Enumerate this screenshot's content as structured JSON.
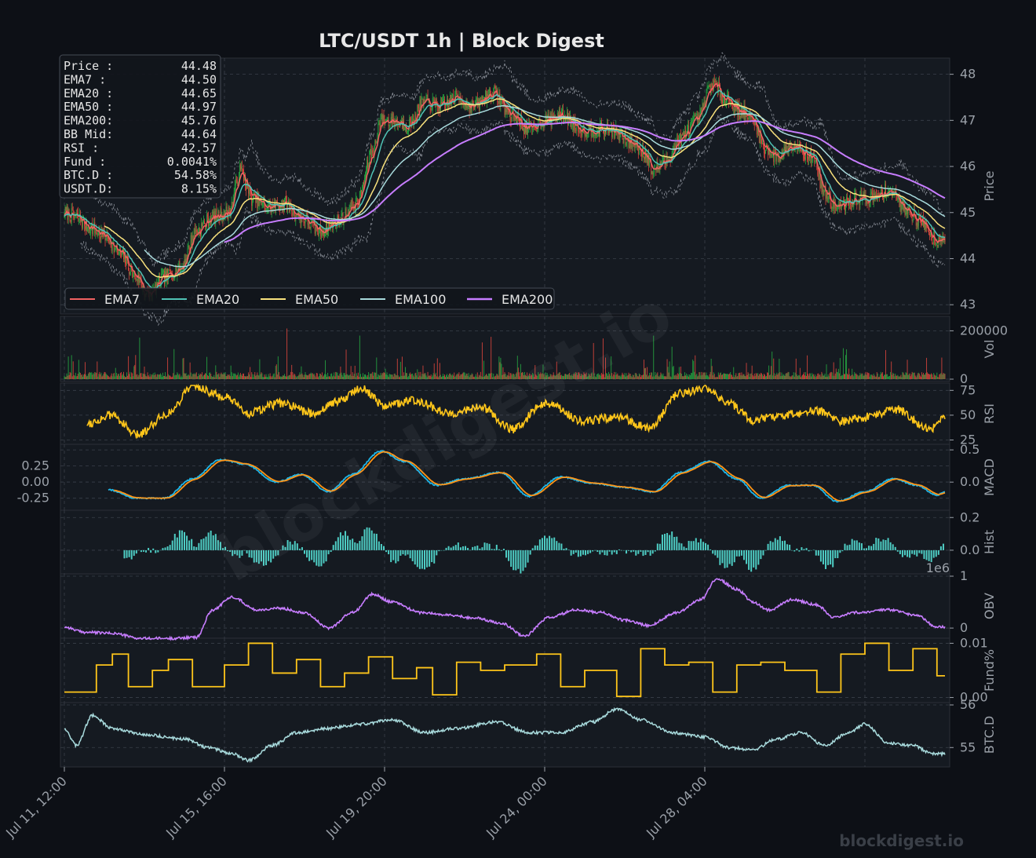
{
  "title": "LTC/USDT  1h  |  Block Digest",
  "watermark": "blockdigest.io",
  "footer_brand": "blockdigest.io",
  "colors": {
    "bg": "#0d1016",
    "panel": "#151a21",
    "grid": "#3a404a",
    "tick": "#9aa0a8",
    "up": "#26a641",
    "down": "#d9453c",
    "ema7": "#f26262",
    "ema20": "#4fc3b5",
    "ema50": "#f9e27d",
    "ema100": "#a8dadc",
    "ema200": "#c77dff",
    "rsi": "#ffc61a",
    "macd": "#1fb6e8",
    "signal": "#ff9416",
    "hist": "#4ecdc4",
    "obv": "#c77dff",
    "fund": "#ffc61a",
    "btcd": "#a8dadc"
  },
  "info_box": [
    {
      "label": "Price :",
      "value": "44.48"
    },
    {
      "label": "EMA7  :",
      "value": "44.50"
    },
    {
      "label": "EMA20 :",
      "value": "44.65"
    },
    {
      "label": "EMA50 :",
      "value": "44.97"
    },
    {
      "label": "EMA200:",
      "value": "45.76"
    },
    {
      "label": "BB Mid:",
      "value": "44.64"
    },
    {
      "label": "RSI   :",
      "value": "42.57"
    },
    {
      "label": "Fund  :",
      "value": "0.0041%"
    },
    {
      "label": "BTC.D :",
      "value": "54.58%"
    },
    {
      "label": "USDT.D:",
      "value": "8.15%"
    }
  ],
  "legend": [
    "EMA7",
    "EMA20",
    "EMA50",
    "EMA100",
    "EMA200"
  ],
  "x_ticks": [
    "Jul 11, 12:00",
    "Jul 15, 16:00",
    "Jul 19, 20:00",
    "Jul 24, 00:00",
    "Jul 28, 04:00"
  ],
  "chart_data": [
    {
      "type": "candlestick",
      "ylabel": "Price",
      "ylim": [
        42.85,
        48.3
      ],
      "yticks": [
        "43",
        "44",
        "45",
        "46",
        "47",
        "48"
      ],
      "series": [
        {
          "name": "EMA7",
          "color_key": "ema7"
        },
        {
          "name": "EMA20",
          "color_key": "ema20"
        },
        {
          "name": "EMA50",
          "color_key": "ema50"
        },
        {
          "name": "EMA100",
          "color_key": "ema100"
        },
        {
          "name": "EMA200",
          "color_key": "ema200"
        }
      ],
      "anchors": [
        [
          0,
          45.0
        ],
        [
          15,
          44.9
        ],
        [
          30,
          44.7
        ],
        [
          50,
          44.5
        ],
        [
          70,
          44.1
        ],
        [
          90,
          43.6
        ],
        [
          105,
          43.2
        ],
        [
          125,
          43.6
        ],
        [
          145,
          43.8
        ],
        [
          165,
          44.6
        ],
        [
          185,
          44.9
        ],
        [
          205,
          45.0
        ],
        [
          220,
          45.9
        ],
        [
          235,
          45.3
        ],
        [
          255,
          45.1
        ],
        [
          275,
          45.2
        ],
        [
          295,
          44.9
        ],
        [
          320,
          44.6
        ],
        [
          340,
          44.8
        ],
        [
          365,
          45.2
        ],
        [
          385,
          46.3
        ],
        [
          395,
          47.0
        ],
        [
          410,
          47.0
        ],
        [
          430,
          46.9
        ],
        [
          450,
          47.4
        ],
        [
          470,
          47.3
        ],
        [
          490,
          47.5
        ],
        [
          510,
          47.3
        ],
        [
          535,
          47.6
        ],
        [
          560,
          47.1
        ],
        [
          580,
          46.8
        ],
        [
          600,
          47.0
        ],
        [
          620,
          47.1
        ],
        [
          650,
          46.8
        ],
        [
          680,
          46.8
        ],
        [
          710,
          46.5
        ],
        [
          725,
          46.3
        ],
        [
          735,
          45.9
        ],
        [
          750,
          46.1
        ],
        [
          770,
          46.6
        ],
        [
          790,
          47.0
        ],
        [
          810,
          47.8
        ],
        [
          825,
          47.5
        ],
        [
          845,
          47.2
        ],
        [
          860,
          47.0
        ],
        [
          875,
          46.4
        ],
        [
          890,
          46.2
        ],
        [
          910,
          46.5
        ],
        [
          935,
          46.2
        ],
        [
          950,
          45.4
        ],
        [
          965,
          45.1
        ],
        [
          990,
          45.3
        ],
        [
          1010,
          45.3
        ],
        [
          1030,
          45.5
        ],
        [
          1050,
          45.1
        ],
        [
          1070,
          44.8
        ],
        [
          1090,
          44.4
        ],
        [
          1100,
          44.5
        ]
      ],
      "bb_band_width": 0.45,
      "bb_offset": 0.2
    },
    {
      "type": "bar",
      "ylabel": "Vol",
      "ylim": [
        0,
        250000
      ],
      "yticks": [
        "0",
        "200000"
      ]
    },
    {
      "type": "line",
      "ylabel": "RSI",
      "ylim": [
        23,
        80
      ],
      "yticks": [
        "25",
        "50",
        "75"
      ],
      "anchors": [
        [
          30,
          42
        ],
        [
          60,
          50
        ],
        [
          90,
          30
        ],
        [
          130,
          52
        ],
        [
          160,
          80
        ],
        [
          200,
          68
        ],
        [
          230,
          52
        ],
        [
          270,
          62
        ],
        [
          310,
          52
        ],
        [
          345,
          65
        ],
        [
          370,
          78
        ],
        [
          400,
          60
        ],
        [
          440,
          65
        ],
        [
          480,
          52
        ],
        [
          520,
          58
        ],
        [
          560,
          36
        ],
        [
          600,
          62
        ],
        [
          650,
          44
        ],
        [
          690,
          48
        ],
        [
          730,
          38
        ],
        [
          770,
          72
        ],
        [
          800,
          78
        ],
        [
          830,
          62
        ],
        [
          860,
          45
        ],
        [
          900,
          50
        ],
        [
          940,
          55
        ],
        [
          970,
          44
        ],
        [
          1000,
          48
        ],
        [
          1040,
          56
        ],
        [
          1080,
          36
        ],
        [
          1100,
          46
        ]
      ]
    },
    {
      "type": "line",
      "ylabel": "MACD",
      "ylim": [
        -0.4,
        0.55
      ],
      "yticks": [
        "-0.25",
        "0.00",
        "0.25"
      ],
      "yticks_right": [
        "0.0",
        "0.5"
      ],
      "series": [
        {
          "name": "MACD",
          "color_key": "macd"
        },
        {
          "name": "Signal",
          "color_key": "signal"
        }
      ],
      "anchors": [
        [
          55,
          -0.12
        ],
        [
          90,
          -0.25
        ],
        [
          125,
          -0.25
        ],
        [
          160,
          0.05
        ],
        [
          195,
          0.35
        ],
        [
          225,
          0.28
        ],
        [
          265,
          0.0
        ],
        [
          295,
          0.12
        ],
        [
          330,
          -0.15
        ],
        [
          360,
          0.12
        ],
        [
          395,
          0.48
        ],
        [
          425,
          0.32
        ],
        [
          465,
          -0.05
        ],
        [
          500,
          0.05
        ],
        [
          545,
          0.15
        ],
        [
          580,
          -0.22
        ],
        [
          620,
          0.08
        ],
        [
          660,
          -0.02
        ],
        [
          700,
          -0.08
        ],
        [
          735,
          -0.15
        ],
        [
          770,
          0.15
        ],
        [
          805,
          0.32
        ],
        [
          840,
          0.05
        ],
        [
          870,
          -0.25
        ],
        [
          905,
          -0.05
        ],
        [
          935,
          -0.05
        ],
        [
          965,
          -0.3
        ],
        [
          1000,
          -0.15
        ],
        [
          1035,
          0.05
        ],
        [
          1065,
          -0.05
        ],
        [
          1090,
          -0.2
        ],
        [
          1100,
          -0.15
        ]
      ]
    },
    {
      "type": "bar",
      "ylabel": "Hist",
      "ylim": [
        -0.13,
        0.23
      ],
      "yticks": [
        "0.0",
        "0.2"
      ]
    },
    {
      "type": "line",
      "ylabel": "OBV",
      "ylim": [
        -0.15,
        1.0
      ],
      "yticks": [
        "0",
        "1"
      ],
      "offset_label": "1e6",
      "anchors": [
        [
          0,
          0.02
        ],
        [
          25,
          -0.08
        ],
        [
          60,
          -0.1
        ],
        [
          95,
          -0.2
        ],
        [
          130,
          -0.2
        ],
        [
          165,
          -0.18
        ],
        [
          185,
          0.35
        ],
        [
          210,
          0.6
        ],
        [
          240,
          0.35
        ],
        [
          270,
          0.38
        ],
        [
          300,
          0.3
        ],
        [
          330,
          0.0
        ],
        [
          360,
          0.3
        ],
        [
          385,
          0.65
        ],
        [
          410,
          0.5
        ],
        [
          445,
          0.3
        ],
        [
          480,
          0.25
        ],
        [
          510,
          0.2
        ],
        [
          545,
          0.1
        ],
        [
          575,
          -0.15
        ],
        [
          605,
          0.2
        ],
        [
          640,
          0.35
        ],
        [
          670,
          0.3
        ],
        [
          700,
          0.15
        ],
        [
          730,
          0.05
        ],
        [
          765,
          0.3
        ],
        [
          795,
          0.55
        ],
        [
          815,
          0.95
        ],
        [
          840,
          0.75
        ],
        [
          860,
          0.5
        ],
        [
          880,
          0.35
        ],
        [
          910,
          0.55
        ],
        [
          940,
          0.45
        ],
        [
          960,
          0.2
        ],
        [
          990,
          0.3
        ],
        [
          1030,
          0.35
        ],
        [
          1065,
          0.25
        ],
        [
          1090,
          0.02
        ],
        [
          1100,
          0.02
        ]
      ]
    },
    {
      "type": "step",
      "ylabel": "Fund%",
      "ylim": [
        -0.0005,
        0.0105
      ],
      "yticks": [
        "0.00",
        "0.01"
      ],
      "anchors": [
        [
          0,
          0.001
        ],
        [
          40,
          0.006
        ],
        [
          60,
          0.008
        ],
        [
          80,
          0.002
        ],
        [
          110,
          0.005
        ],
        [
          130,
          0.007
        ],
        [
          160,
          0.002
        ],
        [
          200,
          0.006
        ],
        [
          230,
          0.01
        ],
        [
          260,
          0.0045
        ],
        [
          290,
          0.007
        ],
        [
          320,
          0.002
        ],
        [
          350,
          0.0045
        ],
        [
          380,
          0.0075
        ],
        [
          410,
          0.0035
        ],
        [
          440,
          0.0055
        ],
        [
          460,
          0.0005
        ],
        [
          490,
          0.0065
        ],
        [
          520,
          0.005
        ],
        [
          550,
          0.006
        ],
        [
          590,
          0.008
        ],
        [
          620,
          0.002
        ],
        [
          650,
          0.005
        ],
        [
          690,
          0.0002
        ],
        [
          720,
          0.009
        ],
        [
          750,
          0.006
        ],
        [
          780,
          0.0065
        ],
        [
          810,
          0.001
        ],
        [
          840,
          0.006
        ],
        [
          870,
          0.0065
        ],
        [
          900,
          0.005
        ],
        [
          940,
          0.001
        ],
        [
          970,
          0.008
        ],
        [
          1000,
          0.01
        ],
        [
          1030,
          0.005
        ],
        [
          1060,
          0.009
        ],
        [
          1090,
          0.004
        ],
        [
          1100,
          0.004
        ]
      ]
    },
    {
      "type": "line",
      "ylabel": "BTC.D",
      "ylim": [
        54.6,
        56.0
      ],
      "yticks": [
        "55",
        "56"
      ],
      "anchors": [
        [
          0,
          55.45
        ],
        [
          15,
          55.05
        ],
        [
          35,
          55.75
        ],
        [
          60,
          55.45
        ],
        [
          100,
          55.3
        ],
        [
          150,
          55.2
        ],
        [
          180,
          55.0
        ],
        [
          210,
          54.85
        ],
        [
          230,
          54.7
        ],
        [
          260,
          55.05
        ],
        [
          290,
          55.35
        ],
        [
          330,
          55.45
        ],
        [
          370,
          55.55
        ],
        [
          410,
          55.65
        ],
        [
          450,
          55.35
        ],
        [
          490,
          55.45
        ],
        [
          540,
          55.6
        ],
        [
          580,
          55.35
        ],
        [
          620,
          55.35
        ],
        [
          660,
          55.6
        ],
        [
          690,
          55.9
        ],
        [
          720,
          55.65
        ],
        [
          760,
          55.35
        ],
        [
          800,
          55.25
        ],
        [
          830,
          55.0
        ],
        [
          860,
          54.95
        ],
        [
          890,
          55.2
        ],
        [
          920,
          55.35
        ],
        [
          950,
          55.05
        ],
        [
          980,
          55.35
        ],
        [
          1000,
          55.55
        ],
        [
          1030,
          55.1
        ],
        [
          1060,
          55.05
        ],
        [
          1085,
          54.85
        ],
        [
          1100,
          54.85
        ]
      ]
    }
  ]
}
